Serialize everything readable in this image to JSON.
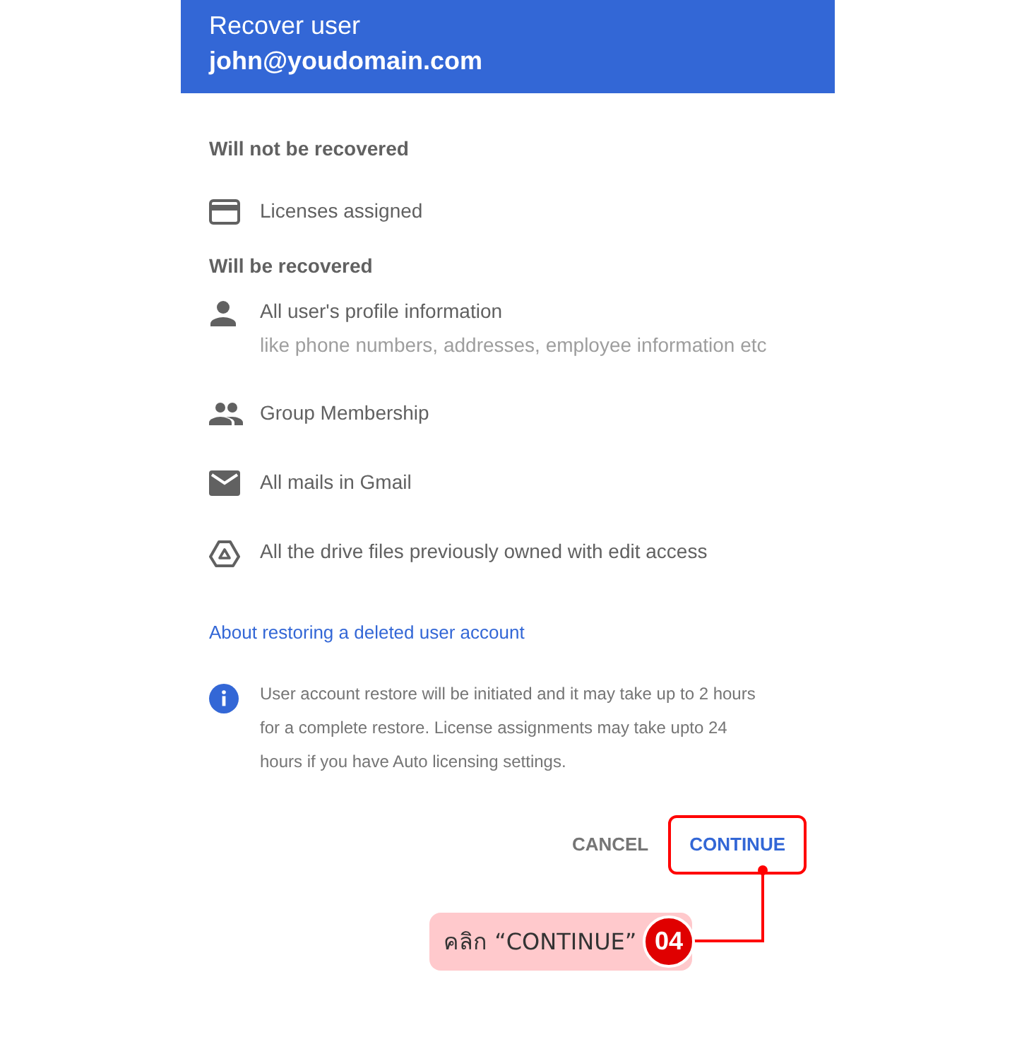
{
  "dialog": {
    "title": "Recover user",
    "email": "john@youdomain.com",
    "sections": [
      {
        "heading": "Will not be recovered",
        "items": [
          {
            "kind": "card",
            "label": "Licenses assigned"
          }
        ]
      },
      {
        "heading": "Will be recovered",
        "items": [
          {
            "kind": "person",
            "label": "All user's profile information",
            "detail": "like phone numbers, addresses, employee information etc"
          },
          {
            "kind": "group",
            "label": "Group Membership"
          },
          {
            "kind": "mail",
            "label": "All mails in Gmail"
          },
          {
            "kind": "drive",
            "label": "All the drive files previously owned with edit access"
          }
        ]
      }
    ],
    "link": "About restoring a deleted user account",
    "info": "User account restore will be initiated and it may take up to 2 hours for a complete restore. License assignments may take upto 24 hours if you have Auto licensing settings.",
    "buttons": [
      {
        "label": "CANCEL",
        "highlighted": false
      },
      {
        "label": "CONTINUE",
        "highlighted": true
      }
    ]
  },
  "annotation": {
    "text": "คลิก “CONTINUE”",
    "step": "04"
  }
}
